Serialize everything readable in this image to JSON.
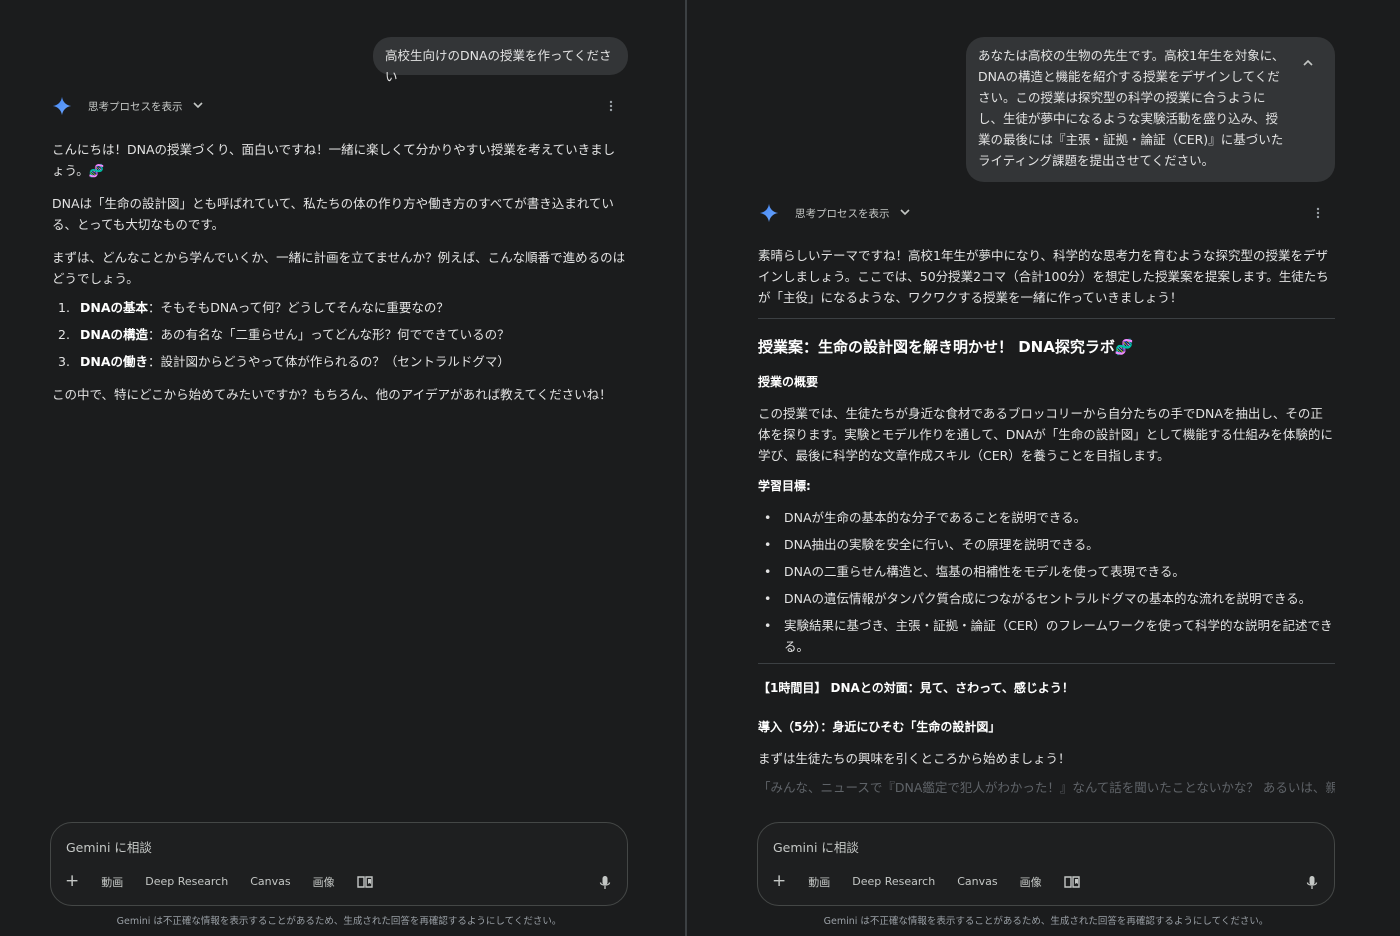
{
  "left": {
    "user_message": "高校生向けのDNAの授業を作ってください",
    "think_label": "思考プロセスを表示",
    "response": {
      "p1a": "こんにちは！DNAの授業づくり、面白いですね！一緒に楽しくて分かりやすい授業を考えていきましょう。",
      "p1_emoji": "🧬",
      "p2": "DNAは「生命の設計図」とも呼ばれていて、私たちの体の作り方や働き方のすべてが書き込まれている、とっても大切なものです。",
      "p3": "まずは、どんなことから学んでいくか、一緒に計画を立てませんか？例えば、こんな順番で進めるのはどうでしょう。",
      "list": [
        {
          "num": "1.",
          "bold": "DNAの基本",
          "text": "：そもそもDNAって何？どうしてそんなに重要なの？"
        },
        {
          "num": "2.",
          "bold": "DNAの構造",
          "text": "：あの有名な「二重らせん」ってどんな形？何でできているの？"
        },
        {
          "num": "3.",
          "bold": "DNAの働き",
          "text": "：設計図からどうやって体が作られるの？（セントラルドグマ）"
        }
      ],
      "p4": "この中で、特にどこから始めてみたいですか？もちろん、他のアイデアがあれば教えてくださいね！"
    },
    "composer": {
      "placeholder": "Gemini に相談",
      "tools": [
        "動画",
        "Deep Research",
        "Canvas",
        "画像"
      ]
    },
    "disclaimer": "Gemini は不正確な情報を表示することがあるため、生成された回答を再確認するようにしてください。"
  },
  "right": {
    "user_message": "あなたは高校の生物の先生です。高校1年生を対象に、DNAの構造と機能を紹介する授業をデザインしてください。この授業は探究型の科学の授業に合うようにし、生徒が夢中になるような実験活動を盛り込み、授業の最後には『主張・証拠・論証（CER)』に基づいたライティング課題を提出させてください。",
    "think_label": "思考プロセスを表示",
    "response": {
      "intro": "素晴らしいテーマですね！高校1年生が夢中になり、科学的な思考力を育むような探究型の授業をデザインしましょう。ここでは、50分授業2コマ（合計100分）を想定した授業案を提案します。生徒たちが「主役」になるような、ワクワクする授業を一緒に作っていきましょう！",
      "title": "授業案：生命の設計図を解き明かせ！ DNA探究ラボ",
      "title_emoji": "🧬",
      "overview_heading": "授業の概要",
      "overview": "この授業では、生徒たちが身近な食材であるブロッコリーから自分たちの手でDNAを抽出し、その正体を探ります。実験とモデル作りを通して、DNAが「生命の設計図」として機能する仕組みを体験的に学び、最後に科学的な文章作成スキル（CER）を養うことを目指します。",
      "goals_heading": "学習目標:",
      "goals": [
        "DNAが生命の基本的な分子であることを説明できる。",
        "DNA抽出の実験を安全に行い、その原理を説明できる。",
        "DNAの二重らせん構造と、塩基の相補性をモデルを使って表現できる。",
        "DNAの遺伝情報がタンパク質合成につながるセントラルドグマの基本的な流れを説明できる。",
        "実験結果に基づき、主張・証拠・論証（CER）のフレームワークを使って科学的な説明を記述できる。"
      ],
      "session1_heading": "【1時間目】 DNAとの対面：見て、さわって、感じよう！",
      "intro_heading": "導入（5分）：身近にひそむ「生命の設計図」",
      "intro_text": "まずは生徒たちの興味を引くところから始めましょう！",
      "faded_text": "「みんな、ニュースで『DNA鑑定で犯人がわかった！』なんて話を聞いたことないかな？ あるいは、親子"
    },
    "composer": {
      "placeholder": "Gemini に相談",
      "tools": [
        "動画",
        "Deep Research",
        "Canvas",
        "画像"
      ]
    },
    "disclaimer": "Gemini は不正確な情報を表示することがあるため、生成された回答を再確認するようにしてください。"
  }
}
